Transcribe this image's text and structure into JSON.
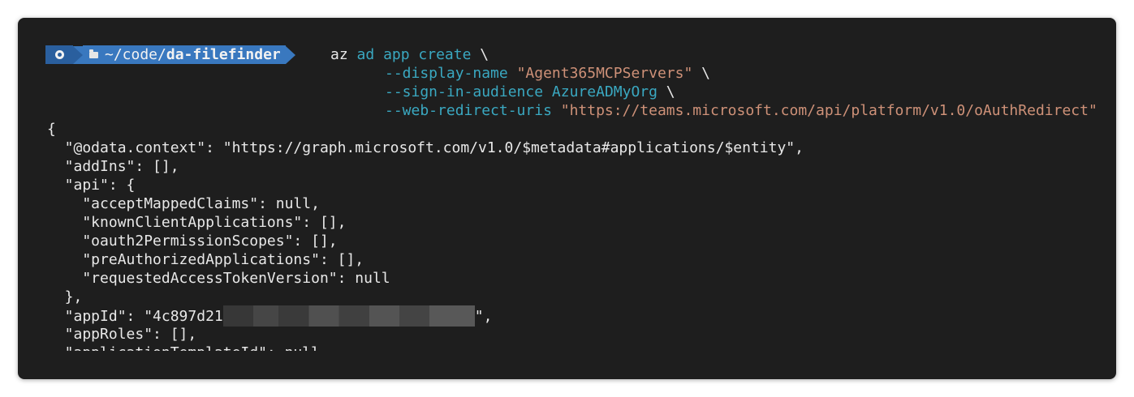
{
  "prompt": {
    "os_icon": "os-logo-icon",
    "folder_icon": "folder-icon",
    "path_prefix": "~/code/",
    "path_dir": "da-filefinder"
  },
  "command": {
    "line1": {
      "az": "az",
      "ad": "ad",
      "app": "app",
      "create": "create",
      "cont": " \\"
    },
    "line2": {
      "flag": "--display-name",
      "value": "\"Agent365MCPServers\"",
      "cont": " \\"
    },
    "line3": {
      "flag": "--sign-in-audience",
      "value": "AzureADMyOrg",
      "cont": " \\"
    },
    "line4": {
      "flag": "--web-redirect-uris",
      "value": "\"https://teams.microsoft.com/api/platform/v1.0/oAuthRedirect\""
    }
  },
  "output": {
    "lines": [
      "{",
      "  \"@odata.context\": \"https://graph.microsoft.com/v1.0/$metadata#applications/$entity\",",
      "  \"addIns\": [],",
      "  \"api\": {",
      "    \"acceptMappedClaims\": null,",
      "    \"knownClientApplications\": [],",
      "    \"oauth2PermissionScopes\": [],",
      "    \"preAuthorizedApplications\": [],",
      "    \"requestedAccessTokenVersion\": null",
      "  },"
    ],
    "appId_prefix": "  \"appId\": \"4c897d21",
    "appId_suffix": "\",",
    "appRoles_line": "  \"appRoles\": [],",
    "partial_line": "  \"applicationTemplateId\": null"
  },
  "colors": {
    "background": "#1e1e1e",
    "text": "#e8e8e8",
    "teal": "#3aa8c1",
    "orange": "#ce9178",
    "prompt_os_bg": "#2a5f9e",
    "prompt_path_bg": "#3978bf"
  }
}
